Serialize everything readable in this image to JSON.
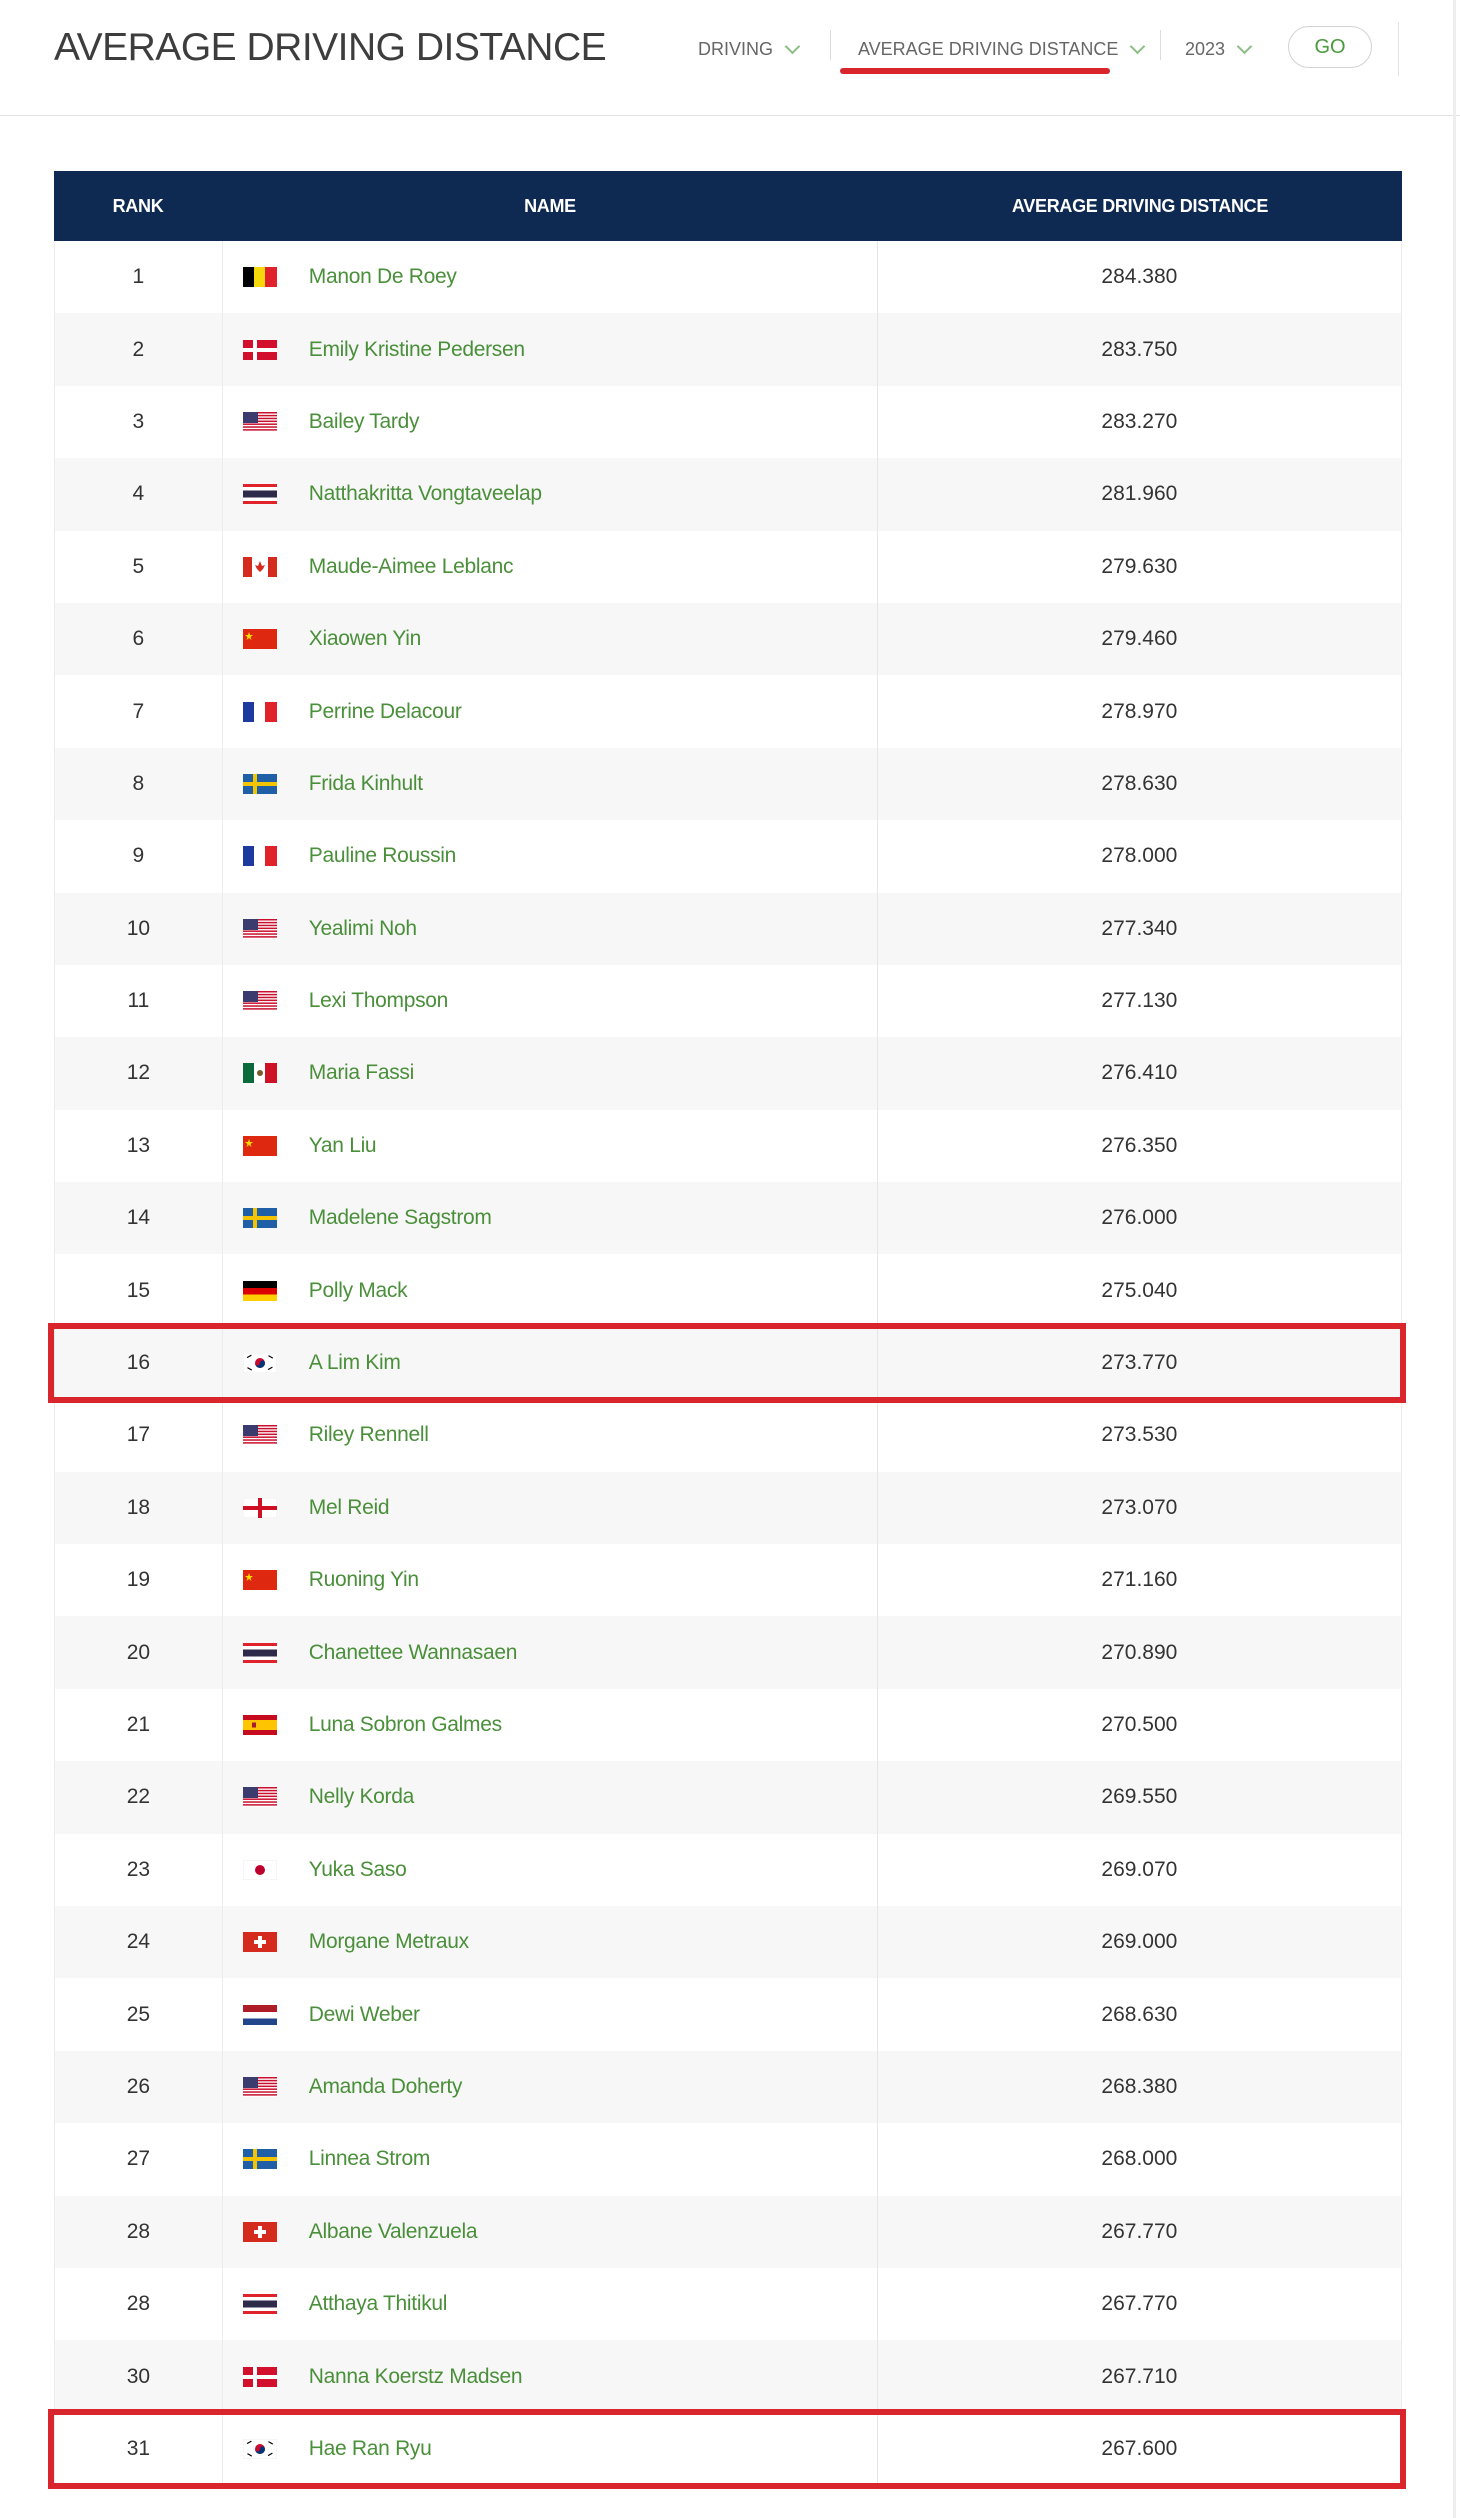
{
  "header": {
    "title": "AVERAGE DRIVING DISTANCE",
    "filter_category": "DRIVING",
    "filter_stat": "AVERAGE DRIVING DISTANCE",
    "filter_year": "2023",
    "go_label": "GO"
  },
  "table": {
    "columns": [
      "RANK",
      "NAME",
      "AVERAGE DRIVING DISTANCE"
    ],
    "rows": [
      {
        "rank": "1",
        "flag": "belgium",
        "name": "Manon De Roey",
        "distance": "284.380"
      },
      {
        "rank": "2",
        "flag": "denmark",
        "name": "Emily Kristine Pedersen",
        "distance": "283.750"
      },
      {
        "rank": "3",
        "flag": "usa",
        "name": "Bailey Tardy",
        "distance": "283.270"
      },
      {
        "rank": "4",
        "flag": "thailand",
        "name": "Natthakritta Vongtaveelap",
        "distance": "281.960"
      },
      {
        "rank": "5",
        "flag": "canada",
        "name": "Maude-Aimee Leblanc",
        "distance": "279.630"
      },
      {
        "rank": "6",
        "flag": "china",
        "name": "Xiaowen Yin",
        "distance": "279.460"
      },
      {
        "rank": "7",
        "flag": "france",
        "name": "Perrine Delacour",
        "distance": "278.970"
      },
      {
        "rank": "8",
        "flag": "sweden",
        "name": "Frida Kinhult",
        "distance": "278.630"
      },
      {
        "rank": "9",
        "flag": "france",
        "name": "Pauline Roussin",
        "distance": "278.000"
      },
      {
        "rank": "10",
        "flag": "usa",
        "name": "Yealimi Noh",
        "distance": "277.340"
      },
      {
        "rank": "11",
        "flag": "usa",
        "name": "Lexi Thompson",
        "distance": "277.130"
      },
      {
        "rank": "12",
        "flag": "mexico",
        "name": "Maria Fassi",
        "distance": "276.410"
      },
      {
        "rank": "13",
        "flag": "china",
        "name": "Yan Liu",
        "distance": "276.350"
      },
      {
        "rank": "14",
        "flag": "sweden",
        "name": "Madelene Sagstrom",
        "distance": "276.000"
      },
      {
        "rank": "15",
        "flag": "germany",
        "name": "Polly Mack",
        "distance": "275.040"
      },
      {
        "rank": "16",
        "flag": "korea",
        "name": "A Lim Kim",
        "distance": "273.770"
      },
      {
        "rank": "17",
        "flag": "usa",
        "name": "Riley Rennell",
        "distance": "273.530"
      },
      {
        "rank": "18",
        "flag": "england",
        "name": "Mel Reid",
        "distance": "273.070"
      },
      {
        "rank": "19",
        "flag": "china",
        "name": "Ruoning Yin",
        "distance": "271.160"
      },
      {
        "rank": "20",
        "flag": "thailand",
        "name": "Chanettee Wannasaen",
        "distance": "270.890"
      },
      {
        "rank": "21",
        "flag": "spain",
        "name": "Luna Sobron Galmes",
        "distance": "270.500"
      },
      {
        "rank": "22",
        "flag": "usa",
        "name": "Nelly Korda",
        "distance": "269.550"
      },
      {
        "rank": "23",
        "flag": "japan",
        "name": "Yuka Saso",
        "distance": "269.070"
      },
      {
        "rank": "24",
        "flag": "switzerland",
        "name": "Morgane Metraux",
        "distance": "269.000"
      },
      {
        "rank": "25",
        "flag": "netherlands",
        "name": "Dewi Weber",
        "distance": "268.630"
      },
      {
        "rank": "26",
        "flag": "usa",
        "name": "Amanda Doherty",
        "distance": "268.380"
      },
      {
        "rank": "27",
        "flag": "sweden",
        "name": "Linnea Strom",
        "distance": "268.000"
      },
      {
        "rank": "28",
        "flag": "switzerland",
        "name": "Albane Valenzuela",
        "distance": "267.770"
      },
      {
        "rank": "28",
        "flag": "thailand",
        "name": "Atthaya Thitikul",
        "distance": "267.770"
      },
      {
        "rank": "30",
        "flag": "denmark",
        "name": "Nanna Koerstz Madsen",
        "distance": "267.710"
      },
      {
        "rank": "31",
        "flag": "korea",
        "name": "Hae Ran Ryu",
        "distance": "267.600"
      }
    ],
    "highlighted_ranks": [
      "16",
      "31"
    ]
  },
  "colors": {
    "header_bg": "#0f2a52",
    "name_link": "#4a8f3a",
    "accent_red": "#d9262c"
  }
}
